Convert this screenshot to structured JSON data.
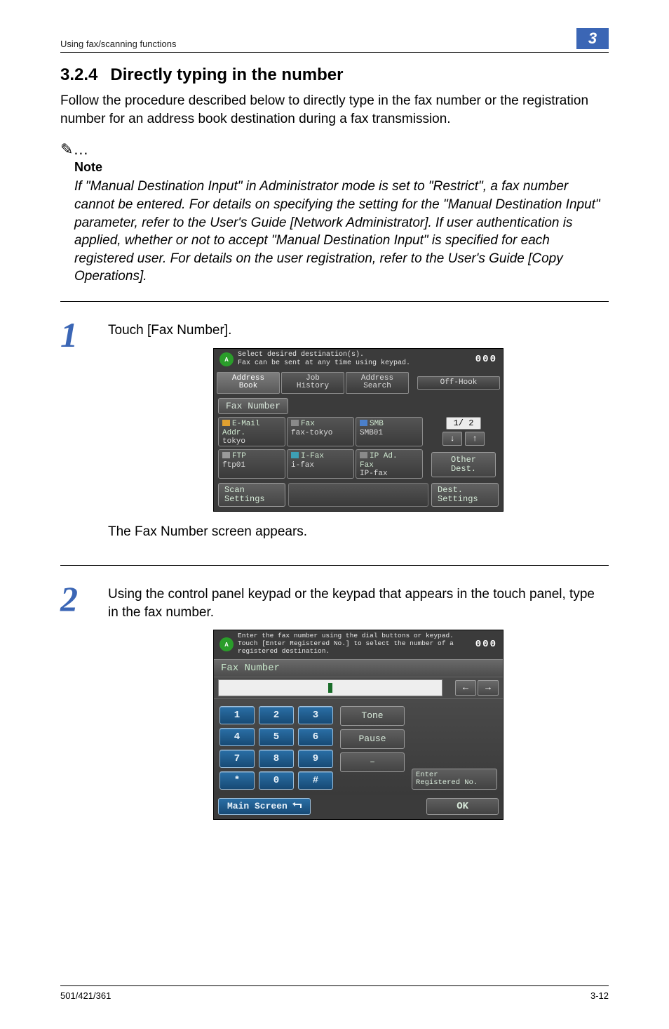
{
  "header": {
    "running_head": "Using fax/scanning functions",
    "chapter_number": "3"
  },
  "section": {
    "number": "3.2.4",
    "title": "Directly typing in the number"
  },
  "intro": "Follow the procedure described below to directly type in the fax number or the registration number for an address book destination during a fax transmission.",
  "note": {
    "icon": "✎…",
    "label": "Note",
    "body": "If \"Manual Destination Input\" in Administrator mode is set to \"Restrict\", a fax number cannot be entered. For details on specifying the setting for the \"Manual Destination Input\" parameter, refer to the User's Guide [Network Administrator]. If user authentication is applied, whether or not to accept \"Manual Destination Input\" is specified for each registered user. For details on the user registration, refer to the User's Guide [Copy Operations]."
  },
  "step1": {
    "num": "1",
    "text": "Touch [Fax Number].",
    "after": "The Fax Number screen appears."
  },
  "panel1": {
    "top_line1": "Select desired destination(s).",
    "top_line2": "Fax can be sent at any time using keypad.",
    "counter": "000",
    "tabs": {
      "address_book": "Address\nBook",
      "job_history": "Job\nHistory",
      "address_search": "Address\nSearch"
    },
    "off_hook": "Off-Hook",
    "fax_number_tab": "Fax Number",
    "dest": {
      "email": {
        "title": "E-Mail\nAddr.",
        "sub": "tokyo"
      },
      "fax": {
        "title": "Fax",
        "sub": "fax-tokyo"
      },
      "smb": {
        "title": "SMB",
        "sub": "SMB01"
      },
      "ftp": {
        "title": "FTP",
        "sub": "ftp01"
      },
      "ifax": {
        "title": "I-Fax",
        "sub": "i-fax"
      },
      "ipfax": {
        "title": "IP Ad.\nFax",
        "sub": "IP-fax"
      }
    },
    "page_indicator": "1/  2",
    "other_dest": "Other\nDest.",
    "scan_settings": "Scan\nSettings",
    "dest_settings": "Dest.\nSettings"
  },
  "step2": {
    "num": "2",
    "text": "Using the control panel keypad or the keypad that appears in the touch panel, type in the fax number."
  },
  "panel2": {
    "top_text": "Enter the fax number using the dial buttons or keypad. Touch [Enter Registered No.] to select the number of a registered destination.",
    "counter": "000",
    "tab": "Fax Number",
    "keys": [
      "1",
      "2",
      "3",
      "4",
      "5",
      "6",
      "7",
      "8",
      "9",
      "*",
      "0",
      "#"
    ],
    "tone": "Tone",
    "pause": "Pause",
    "dash": "–",
    "enter_reg": "Enter\nRegistered No.",
    "main_screen": "Main Screen",
    "ok": "OK"
  },
  "footer": {
    "left": "501/421/361",
    "right": "3-12"
  }
}
